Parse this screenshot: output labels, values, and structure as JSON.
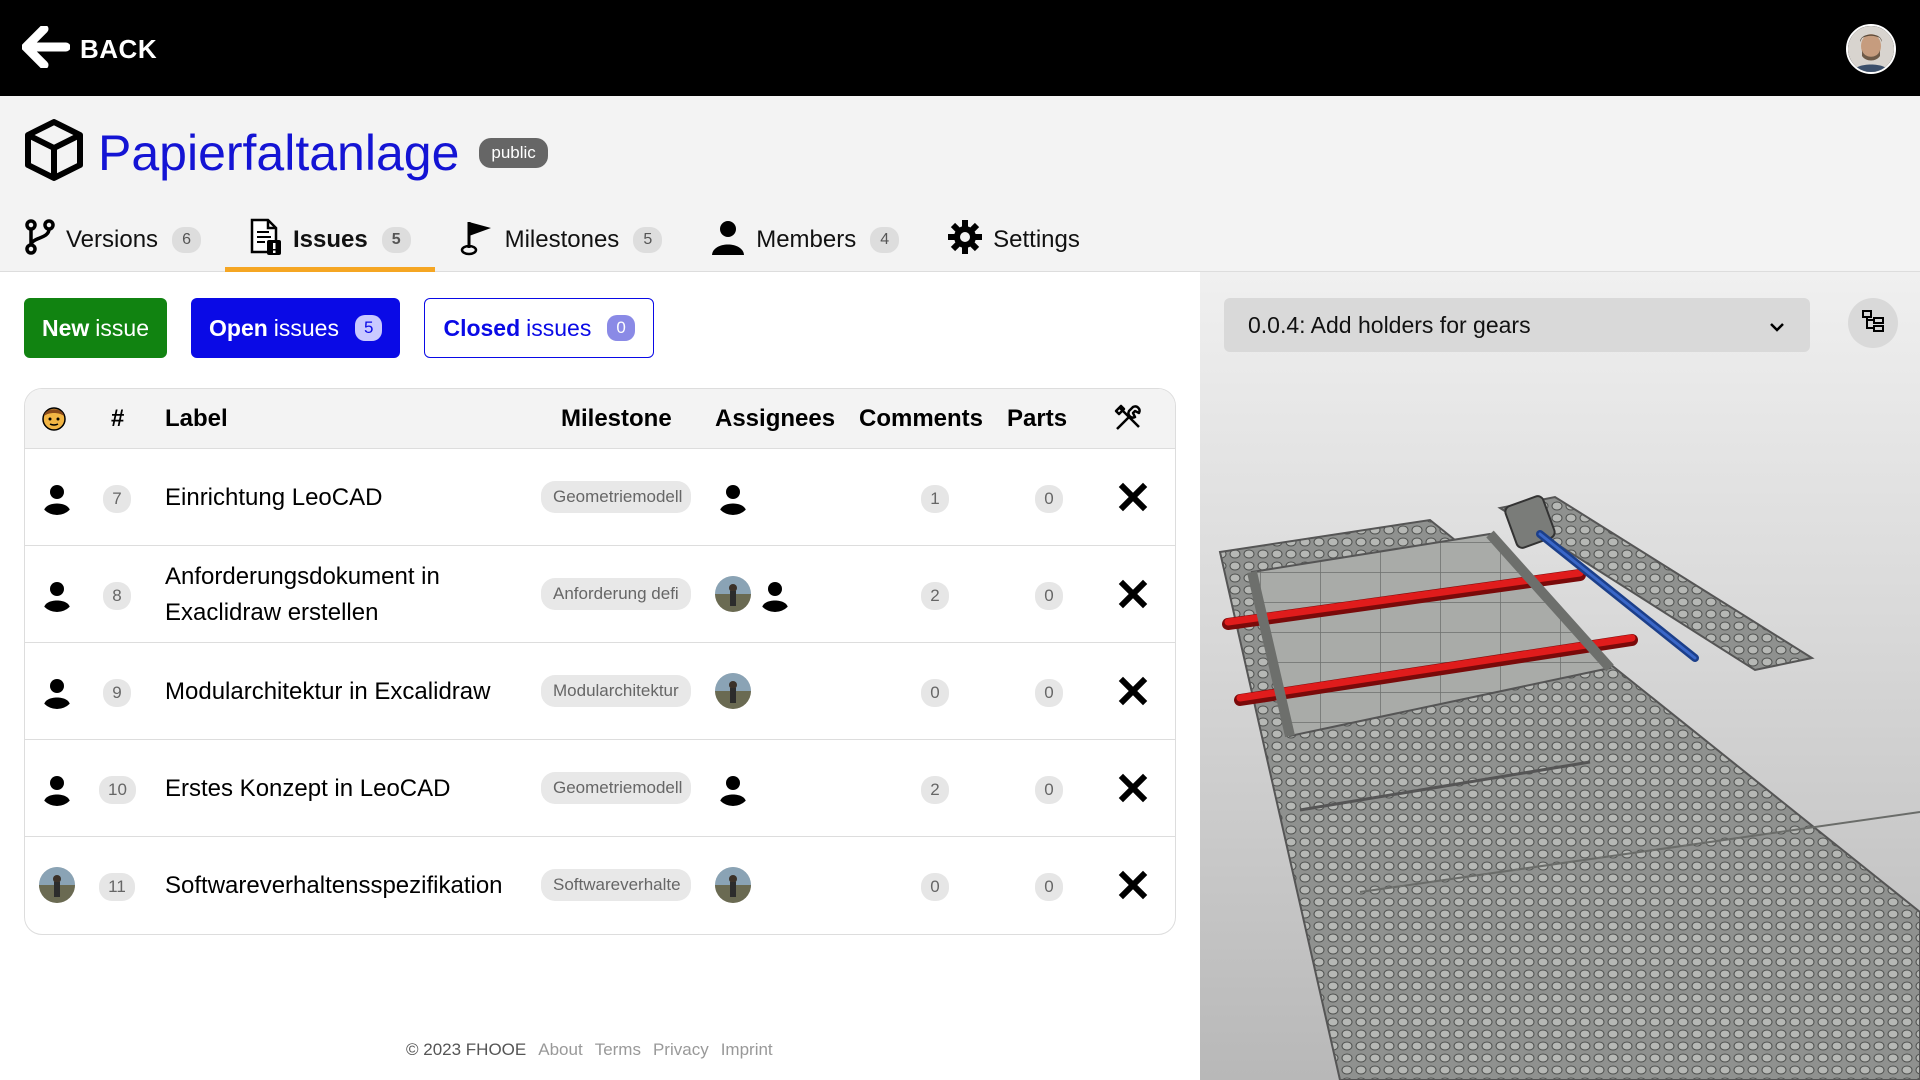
{
  "topbar": {
    "back_label": "BACK"
  },
  "project": {
    "title": "Papierfaltanlage",
    "visibility": "public"
  },
  "tabs": [
    {
      "label": "Versions",
      "count": "6"
    },
    {
      "label": "Issues",
      "count": "5"
    },
    {
      "label": "Milestones",
      "count": "5"
    },
    {
      "label": "Members",
      "count": "4"
    },
    {
      "label": "Settings"
    }
  ],
  "buttons": {
    "new_bold": "New",
    "new_rest": "issue",
    "open_bold": "Open",
    "open_rest": "issues",
    "open_count": "5",
    "closed_bold": "Closed",
    "closed_rest": "issues",
    "closed_count": "0"
  },
  "table": {
    "headers": {
      "num": "#",
      "label": "Label",
      "milestone": "Milestone",
      "assignees": "Assignees",
      "comments": "Comments",
      "parts": "Parts"
    },
    "rows": [
      {
        "num": "7",
        "label": "Einrichtung LeoCAD",
        "milestone": "Geometriemodell",
        "comments": "1",
        "parts": "0"
      },
      {
        "num": "8",
        "label": "Anforderungsdokument in Exaclidraw erstellen",
        "milestone": "Anforderung defi",
        "comments": "2",
        "parts": "0"
      },
      {
        "num": "9",
        "label": "Modularchitektur in Excalidraw",
        "milestone": "Modularchitektur",
        "comments": "0",
        "parts": "0"
      },
      {
        "num": "10",
        "label": "Erstes Konzept in LeoCAD",
        "milestone": "Geometriemodell",
        "comments": "2",
        "parts": "0"
      },
      {
        "num": "11",
        "label": "Softwareverhaltensspezifikation",
        "milestone": "Softwareverhalte",
        "comments": "0",
        "parts": "0"
      }
    ]
  },
  "footer": {
    "copyright": "© 2023 FHOOE",
    "about": "About",
    "terms": "Terms",
    "privacy": "Privacy",
    "imprint": "Imprint"
  },
  "viewer": {
    "version_select": "0.0.4: Add holders for gears"
  },
  "colors": {
    "accent": "#f5a623",
    "primary": "#0a0ae6",
    "success": "#118311",
    "title": "#1414d4"
  }
}
